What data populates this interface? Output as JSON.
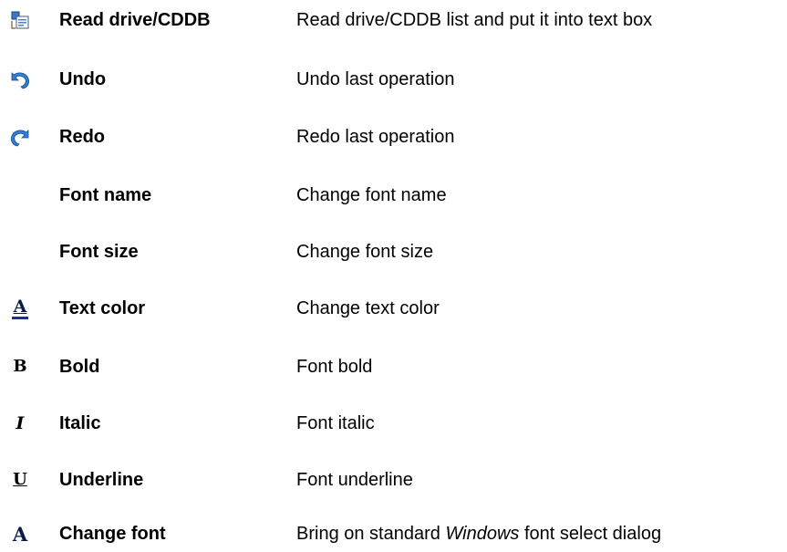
{
  "rows": [
    {
      "icon": "read-drive-icon",
      "name": "Read drive/CDDB",
      "desc": "Read drive/CDDB list and put it into text box"
    },
    {
      "icon": "undo-icon",
      "name": "Undo",
      "desc": "Undo last operation"
    },
    {
      "icon": "redo-icon",
      "name": "Redo",
      "desc": "Redo last operation"
    },
    {
      "icon": "",
      "name": "Font name",
      "desc": "Change font name"
    },
    {
      "icon": "",
      "name": "Font size",
      "desc": "Change font size"
    },
    {
      "icon": "text-color-icon",
      "name": "Text color",
      "desc": "Change text color"
    },
    {
      "icon": "bold-icon",
      "name": "Bold",
      "desc": "Font bold"
    },
    {
      "icon": "italic-icon",
      "name": "Italic",
      "desc": "Font italic"
    },
    {
      "icon": "underline-icon",
      "name": "Underline",
      "desc": "Font underline"
    },
    {
      "icon": "change-font-icon",
      "name": "Change font",
      "desc_before": "Bring on standard ",
      "desc_italic": "Windows",
      "desc_after": " font select dialog"
    }
  ],
  "icon_glyphs": {
    "text_color": "A",
    "bold": "B",
    "italic": "I",
    "underline": "U",
    "change_font": "A"
  },
  "colors": {
    "undo_blue": "#2f7fd6",
    "text_color_bar": "#1a2aa8",
    "icon_dark": "#0a1a4a"
  }
}
